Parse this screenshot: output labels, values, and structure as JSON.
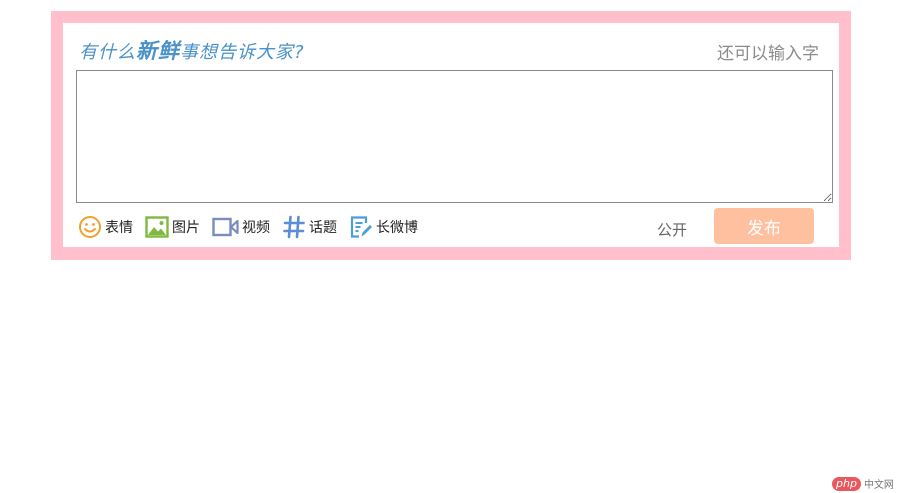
{
  "composer": {
    "title_prefix": "有什么",
    "title_emphasis": "新鲜",
    "title_suffix": "事想告诉大家?",
    "counter_text": "还可以输入字",
    "text_value": "",
    "tools": [
      {
        "label": "表情",
        "icon": "smiley-icon",
        "color": "#f0a030"
      },
      {
        "label": "图片",
        "icon": "image-icon",
        "color": "#7fba3e"
      },
      {
        "label": "视频",
        "icon": "video-icon",
        "color": "#7a8bbd"
      },
      {
        "label": "话题",
        "icon": "hashtag-icon",
        "color": "#5b8ed6"
      },
      {
        "label": "长微博",
        "icon": "long-post-icon",
        "color": "#4a9fd8"
      }
    ],
    "visibility_label": "公开",
    "publish_label": "发布"
  },
  "colors": {
    "frame": "#ffc0cb",
    "title": "#4a92c8",
    "publish_bg": "#ffc09f"
  },
  "watermark": {
    "brand": "php",
    "site": "中文网"
  }
}
